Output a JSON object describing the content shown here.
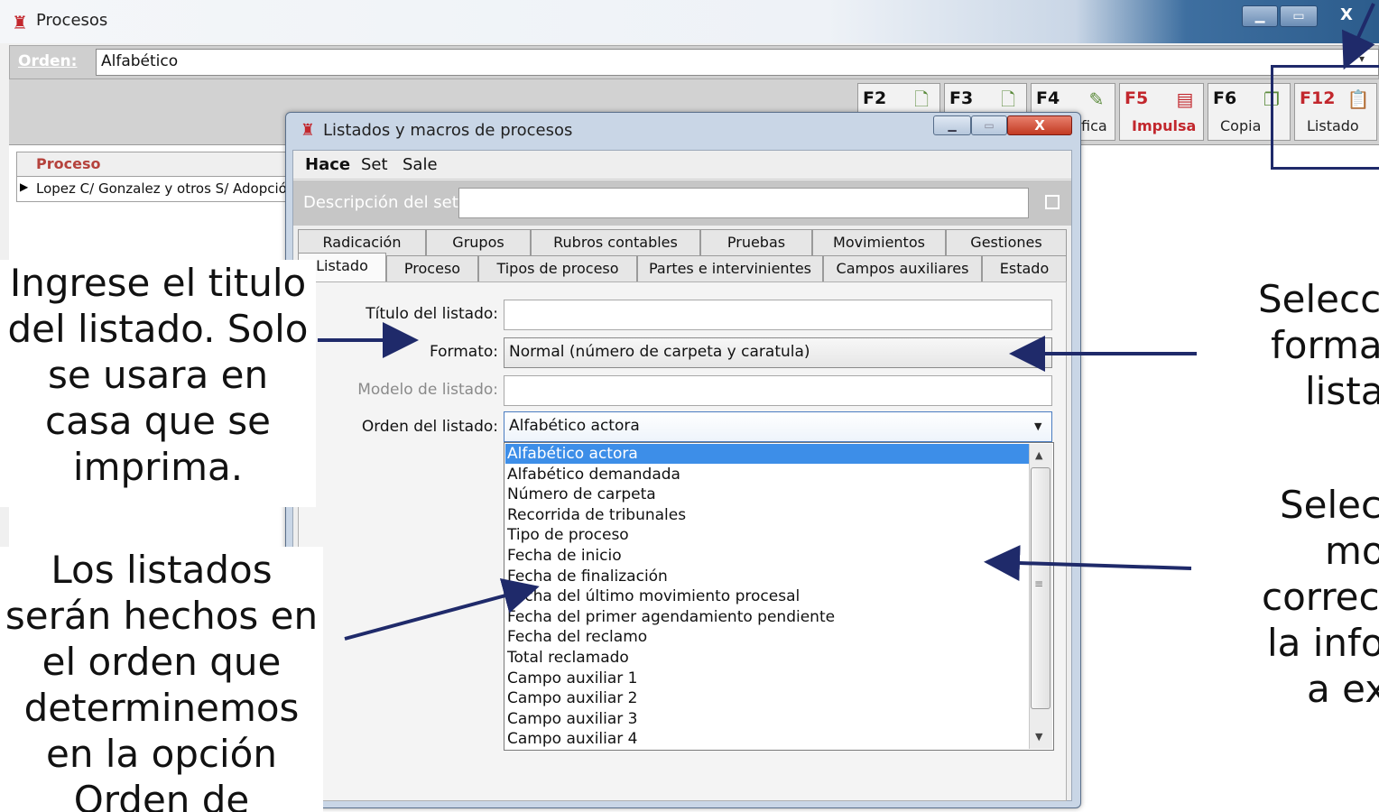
{
  "main_window": {
    "title": "Procesos",
    "minimize": "▁",
    "maximize": "▭",
    "close": "X",
    "orden_label": "Orden:",
    "orden_value": "Alfabético",
    "orden_arrow": "▾",
    "fkeys": [
      {
        "key": "F2",
        "label": "",
        "icon": "new-doc-icon",
        "glyph": "🗋",
        "color": "#111111"
      },
      {
        "key": "F3",
        "label": "",
        "icon": "delete-doc-icon",
        "glyph": "🗋",
        "color": "#111111"
      },
      {
        "key": "F4",
        "label": "fica",
        "icon": "edit-icon",
        "glyph": "✎",
        "color": "#111111"
      },
      {
        "key": "F5",
        "label": "Impulsa",
        "icon": "impulsa-icon",
        "glyph": "▤",
        "color": "#c2272d"
      },
      {
        "key": "F6",
        "label": "Copia",
        "icon": "copy-icon",
        "glyph": "❐",
        "color": "#111111"
      },
      {
        "key": "F12",
        "label": "Listado",
        "icon": "clipboard-icon",
        "glyph": "📋",
        "color": "#c2272d"
      }
    ],
    "grid": {
      "header": "Proceso",
      "row_marker": "▶",
      "row": "Lopez C/ Gonzalez y otros S/ Adopción"
    }
  },
  "dialog": {
    "title": "Listados y macros de procesos",
    "close": "X",
    "menu": [
      "Hace",
      "Set",
      "Sale"
    ],
    "description_label": "Descripción del set:",
    "tabs_row1": [
      "Radicación",
      "Grupos",
      "Rubros contables",
      "Pruebas",
      "Movimientos",
      "Gestiones"
    ],
    "tabs_row2": [
      "Listado",
      "Proceso",
      "Tipos de proceso",
      "Partes e intervinientes",
      "Campos auxiliares",
      "Estado"
    ],
    "fields": {
      "titulo_label": "Título del listado:",
      "titulo_value": "",
      "formato_label": "Formato:",
      "formato_value": "Normal (número de carpeta y caratula)",
      "modelo_label": "Modelo de listado:",
      "modelo_value": "",
      "orden_label": "Orden del listado:",
      "orden_value": "Alfabético actora"
    },
    "orden_options": [
      "Alfabético actora",
      "Alfabético demandada",
      "Número de carpeta",
      "Recorrida de tribunales",
      "Tipo de proceso",
      "Fecha de inicio",
      "Fecha de finalización",
      "Fecha del último movimiento procesal",
      "Fecha del primer agendamiento pendiente",
      "Fecha del reclamo",
      "Total reclamado",
      "Campo auxiliar 1",
      "Campo auxiliar 2",
      "Campo auxiliar 3",
      "Campo auxiliar 4"
    ],
    "selected_index": 0,
    "scroll_up": "▲",
    "scroll_down": "▼",
    "scroll_grip": "≡",
    "combo_arrow": "▼"
  },
  "annotations": {
    "note1": "Ingrese el titulo del listado. Solo se usara en casa que se imprima.",
    "note2": "Los listados serán hechos en el orden que determinemos en la opción Orden de Listado",
    "note3": [
      "Seleccio",
      "format",
      "listad"
    ],
    "note4": [
      "Selecc",
      "mo",
      "correct",
      "la infor",
      "a ex"
    ]
  },
  "colors": {
    "selection": "#3d8ee8",
    "arrow": "#1f2a6a",
    "brand_red": "#c2272d",
    "dialog_frame": "#c9d6e6"
  }
}
